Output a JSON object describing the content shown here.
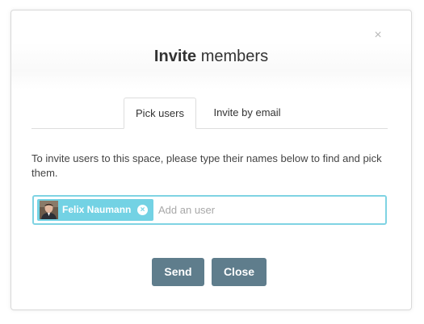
{
  "dialog": {
    "title_strong": "Invite",
    "title_rest": " members",
    "close_glyph": "×"
  },
  "tabs": [
    {
      "label": "Pick users",
      "active": true
    },
    {
      "label": "Invite by email",
      "active": false
    }
  ],
  "instructions": "To invite users to this space, please type their names below to find and pick them.",
  "user_picker": {
    "selected": [
      {
        "name": "Felix Naumann",
        "remove_glyph": "×"
      }
    ],
    "placeholder": "Add an user",
    "value": ""
  },
  "buttons": {
    "send": "Send",
    "close": "Close"
  },
  "colors": {
    "accent": "#73d2e4",
    "input_border": "#7fd3e3",
    "button": "#5f7d8c"
  },
  "icons": {
    "close": "close-icon",
    "chip_remove": "remove-circle-icon",
    "avatar": "user-avatar"
  }
}
